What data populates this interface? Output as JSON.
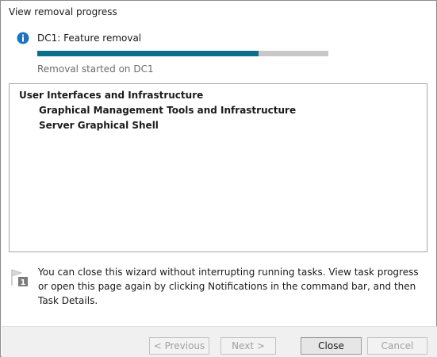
{
  "window": {
    "title": "View removal progress"
  },
  "task": {
    "title": "DC1: Feature removal",
    "progress_percent": 76,
    "status": "Removal started on DC1",
    "info_icon": "info-icon"
  },
  "results": {
    "root": "User Interfaces and Infrastructure",
    "children": [
      "Graphical Management Tools and Infrastructure",
      "Server Graphical Shell"
    ]
  },
  "notice": {
    "text": "You can close this wizard without interrupting running tasks. View task progress or open this page again by clicking Notifications in the command bar, and then Task Details.",
    "icon": "notification-flag-icon",
    "icon_badge": "1"
  },
  "buttons": {
    "previous": "< Previous",
    "next": "Next >",
    "close": "Close",
    "cancel": "Cancel"
  },
  "colors": {
    "progress_fill": "#0c6e8a",
    "progress_track": "#c8c8c8",
    "info_icon": "#1e73be"
  }
}
